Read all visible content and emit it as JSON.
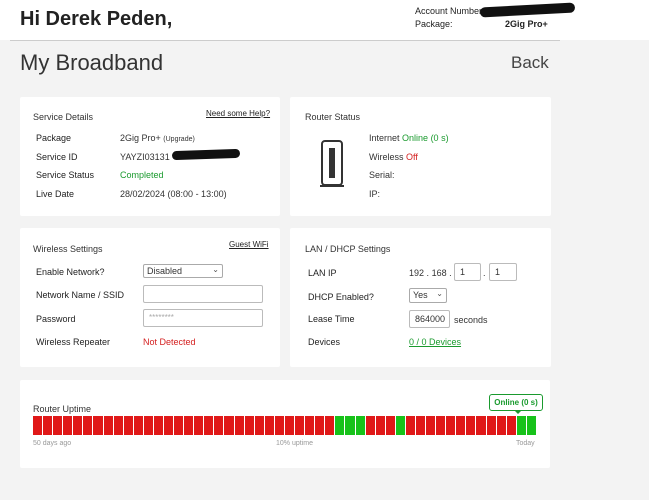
{
  "header": {
    "greeting": "Hi Derek Peden,",
    "account_number_label": "Account Number:",
    "package_label": "Package:",
    "package_value": "2Gig Pro+"
  },
  "page": {
    "title": "My Broadband",
    "back_label": "Back"
  },
  "service": {
    "title": "Service Details",
    "help_link": "Need some Help?",
    "package_label": "Package",
    "package_value": "2Gig Pro+",
    "upgrade_label": "(Upgrade)",
    "service_id_label": "Service ID",
    "service_id_value": "YAYZI03131",
    "status_label": "Service Status",
    "status_value": "Completed",
    "live_label": "Live Date",
    "live_value": "28/02/2024 (08:00 - 13:00)"
  },
  "router": {
    "title": "Router Status",
    "internet_label": "Internet",
    "internet_value": "Online (0 s)",
    "wireless_label": "Wireless",
    "wireless_value": "Off",
    "serial_label": "Serial:",
    "ip_label": "IP:"
  },
  "wireless": {
    "title": "Wireless Settings",
    "guest_link": "Guest WiFi",
    "enable_label": "Enable Network?",
    "enable_value": "Disabled",
    "ssid_label": "Network Name / SSID",
    "ssid_value": "",
    "password_label": "Password",
    "password_placeholder": "********",
    "repeater_label": "Wireless Repeater",
    "repeater_value": "Not Detected"
  },
  "lan": {
    "title": "LAN / DHCP Settings",
    "lanip_label": "LAN IP",
    "ip_a": "192",
    "ip_b": "168",
    "ip_c": "1",
    "ip_d": "1",
    "dot": ".",
    "dhcp_label": "DHCP Enabled?",
    "dhcp_value": "Yes",
    "lease_label": "Lease Time",
    "lease_value": "864000",
    "lease_unit": "seconds",
    "devices_label": "Devices",
    "devices_value": "0 / 0 Devices"
  },
  "uptime": {
    "title": "Router Uptime",
    "badge": "Online (0 s)",
    "left_label": "50 days ago",
    "mid_label": "10% uptime",
    "right_label": "Today",
    "colors": {
      "down": "#e01818",
      "up": "#17c21a"
    },
    "segments": [
      0,
      0,
      0,
      0,
      0,
      0,
      0,
      0,
      0,
      0,
      0,
      0,
      0,
      0,
      0,
      0,
      0,
      0,
      0,
      0,
      0,
      0,
      0,
      0,
      0,
      0,
      0,
      0,
      0,
      0,
      1,
      1,
      1,
      0,
      0,
      0,
      1,
      0,
      0,
      0,
      0,
      0,
      0,
      0,
      0,
      0,
      0,
      0,
      1,
      1
    ]
  }
}
